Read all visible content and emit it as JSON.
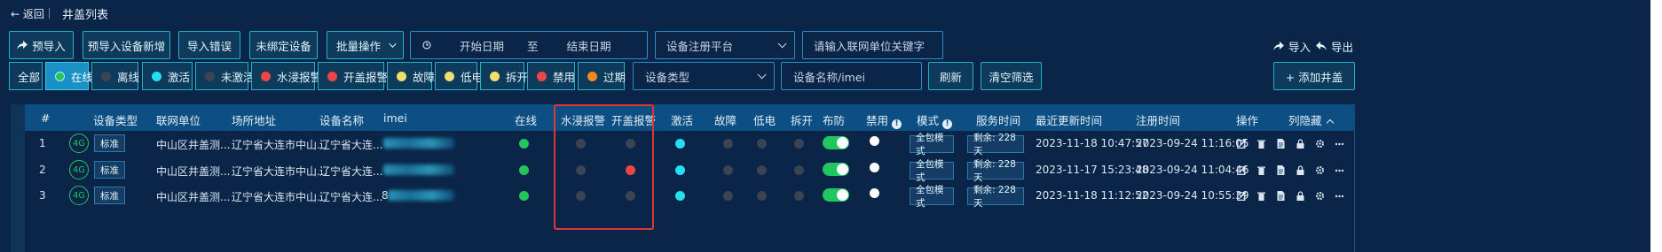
{
  "header": {
    "back": "← 返回",
    "title": "井盖列表"
  },
  "toolbar": {
    "pre_import": "预导入",
    "pre_import_new": "预导入设备新增",
    "import_error": "导入错误",
    "unbound": "未绑定设备",
    "batch": "批量操作",
    "start_date": "开始日期",
    "to": "至",
    "end_date": "结束日期",
    "platform_placeholder": "设备注册平台",
    "unit_placeholder": "请输入联网单位关键字",
    "import": "导入",
    "export": "导出"
  },
  "filters": [
    {
      "label": "全部",
      "color": ""
    },
    {
      "label": "在线",
      "color": "#24c45c"
    },
    {
      "label": "离线",
      "color": "#3a4452"
    },
    {
      "label": "激活",
      "color": "#22e0f0"
    },
    {
      "label": "未激活",
      "color": "#3a4452"
    },
    {
      "label": "水浸报警",
      "color": "#ee4646"
    },
    {
      "label": "开盖报警",
      "color": "#ee4646"
    },
    {
      "label": "故障",
      "color": "#f4df6e"
    },
    {
      "label": "低电",
      "color": "#f4df6e"
    },
    {
      "label": "拆开",
      "color": "#f4df6e"
    },
    {
      "label": "禁用",
      "color": "#ee4646"
    },
    {
      "label": "过期",
      "color": "#f08a1c"
    }
  ],
  "search": {
    "device_type": "设备类型",
    "name_imei": "设备名称/imei",
    "refresh": "刷新",
    "clear": "清空筛选",
    "add": "+ 添加井盖"
  },
  "columns": {
    "index": "#",
    "type": "设备类型",
    "unit": "联网单位",
    "address": "场所地址",
    "name": "设备名称",
    "imei": "imei",
    "online": "在线",
    "water": "水浸报警",
    "cover": "开盖报警",
    "activate": "激活",
    "fault": "故障",
    "low": "低电",
    "open": "拆开",
    "defense": "布防",
    "disable": "禁用",
    "mode": "模式",
    "service": "服务时间",
    "updated": "最近更新时间",
    "registered": "注册时间",
    "ops": "操作",
    "hide": "列隐藏"
  },
  "rows": [
    {
      "index": "1",
      "net": "4G",
      "type": "标准",
      "unit": "中山区井盖测...",
      "address": "辽宁省大连市中山...",
      "name": "辽宁省大连...",
      "mode": "全包模式",
      "service": "剩余: 228天",
      "updated": "2023-11-18 10:47:57",
      "registered": "2023-09-24 11:16:05",
      "cover_alarm": false
    },
    {
      "index": "2",
      "net": "4G",
      "type": "标准",
      "unit": "中山区井盖测...",
      "address": "辽宁省大连市中山...",
      "name": "辽宁省大连...",
      "mode": "全包模式",
      "service": "剩余: 228天",
      "updated": "2023-11-17 15:23:48",
      "registered": "2023-09-24 11:04:46",
      "cover_alarm": true
    },
    {
      "index": "3",
      "net": "4G",
      "type": "标准",
      "unit": "中山区井盖测...",
      "address": "辽宁省大连市中山...",
      "name": "辽宁省大连...",
      "imei_prefix": "8",
      "mode": "全包模式",
      "service": "剩余: 228天",
      "updated": "2023-11-18 11:12:52",
      "registered": "2023-09-24 10:55:39",
      "cover_alarm": false
    }
  ],
  "colors": {
    "bg": "#0a2547",
    "accent": "#1fb2c9",
    "header": "#0d4f83",
    "online": "#24c45c",
    "alarm": "#ee4646",
    "active": "#22e0f0",
    "idle": "#3a4452",
    "highlight": "#e03636"
  }
}
